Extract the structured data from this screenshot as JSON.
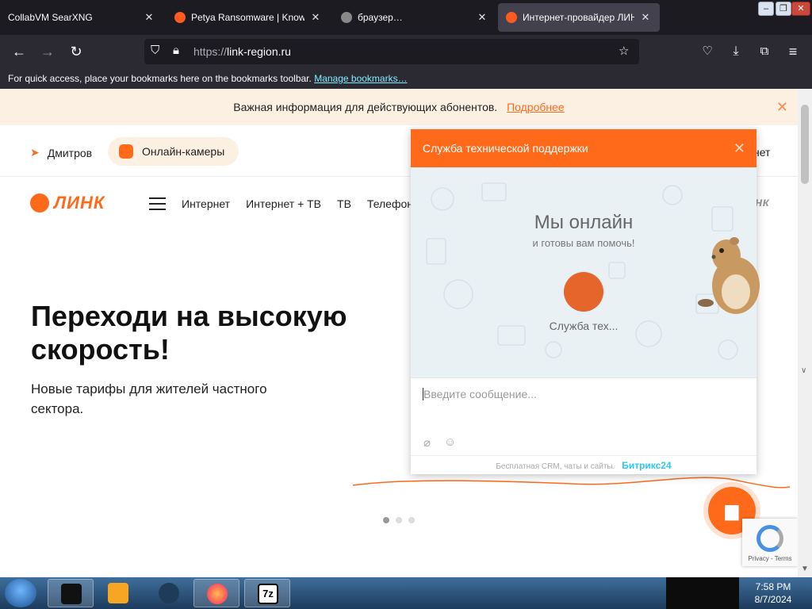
{
  "browser": {
    "tabs": [
      {
        "title": "CollabVM SearXNG"
      },
      {
        "title": "Petya Ransomware | KnowBe"
      },
      {
        "title": "браузер…"
      },
      {
        "title": "Интернет-провайдер ЛИНК"
      }
    ],
    "url": {
      "scheme": "https://",
      "host": "link-region.ru"
    },
    "bookmarks_hint": "For quick access, place your bookmarks here on the bookmarks toolbar.",
    "bookmarks_link": "Manage bookmarks…"
  },
  "page": {
    "notice": {
      "text": "Важная информация для действующих абонентов.",
      "link": "Подробнее"
    },
    "location": "Дмитров",
    "cameras": "Онлайн-камеры",
    "right_text": "нет",
    "logo": "ЛИНК",
    "menu": [
      "Интернет",
      "Интернет + ТВ",
      "ТВ",
      "Телефони"
    ],
    "hero_title": "Переходи на высокую скорость!",
    "hero_sub": "Новые тарифы для жителей частного сектора."
  },
  "chat": {
    "header": "Служба технической поддержки",
    "online": "Мы онлайн",
    "ready": "и готовы вам помочь!",
    "operator": "Служба тех...",
    "placeholder": "Введите сообщение...",
    "footer": "Бесплатная CRM, чаты и сайты.",
    "brand": "Битрикс24"
  },
  "recaptcha": {
    "terms": "Privacy - Terms"
  },
  "taskbar": {
    "time": "7:58 PM",
    "date": "8/7/2024"
  },
  "colors": {
    "accent": "#ff6a1a",
    "browser_dark": "#1c1b22",
    "toolbar": "#2b2a33"
  }
}
